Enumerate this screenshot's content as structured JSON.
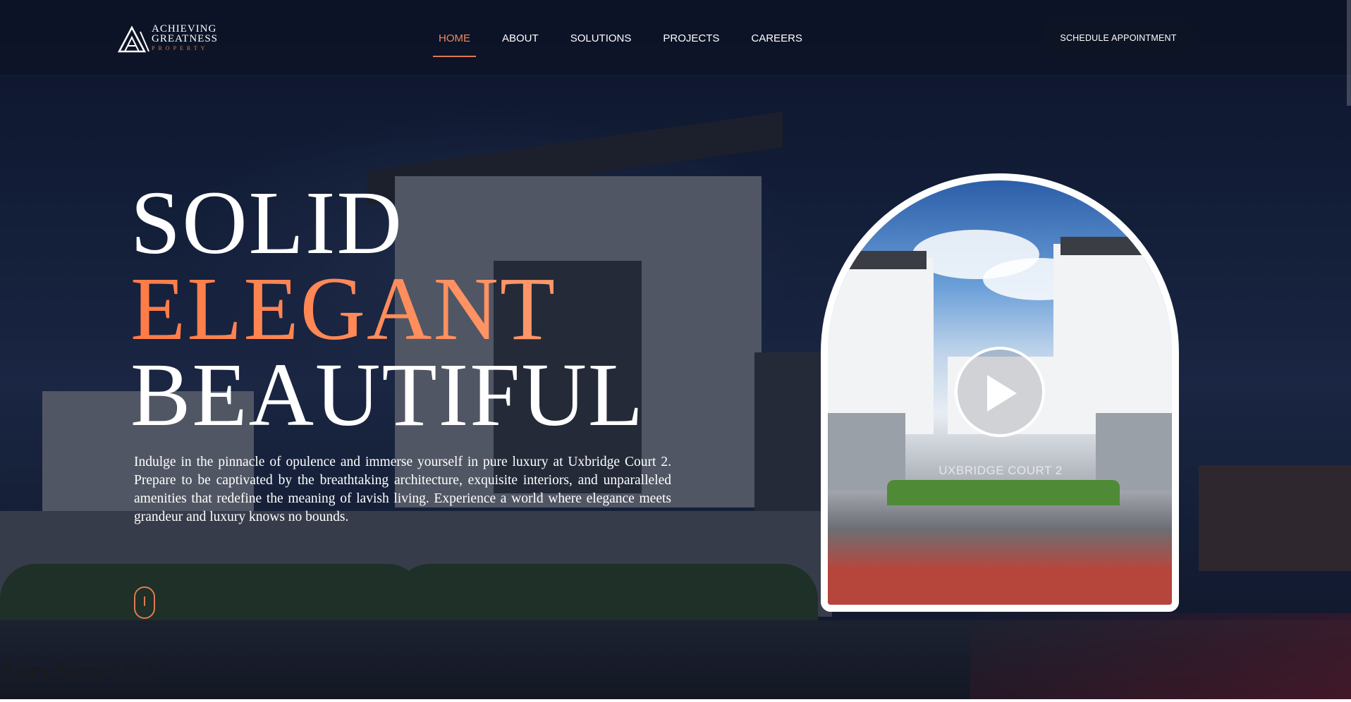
{
  "brand": {
    "line1": "ACHIEVING",
    "line2": "GREATNESS",
    "line3": "PROPERTY",
    "accent_color": "#e07a4f"
  },
  "nav": {
    "items": [
      {
        "label": "HOME",
        "active": true
      },
      {
        "label": "ABOUT",
        "active": false
      },
      {
        "label": "SOLUTIONS",
        "active": false
      },
      {
        "label": "PROJECTS",
        "active": false
      },
      {
        "label": "CAREERS",
        "active": false
      }
    ]
  },
  "cta": {
    "label": "SCHEDULE APPOINTMENT"
  },
  "hero": {
    "line1": "SOLID",
    "line2": "ELEGANT",
    "line3": "BEAUTIFUL",
    "description": "Indulge in the pinnacle of opulence and immerse yourself in pure luxury at Uxbridge Court 2. Prepare to be captivated by the breathtaking architecture, exquisite interiors, and unparalleled amenities that redefine the meaning of lavish living. Experience a world where elegance meets grandeur and luxury knows no bounds."
  },
  "media": {
    "sign_text": "UXBRIDGE COURT 2",
    "play_icon": "play-icon"
  },
  "footer_note": "I am Sorry !!!!!"
}
